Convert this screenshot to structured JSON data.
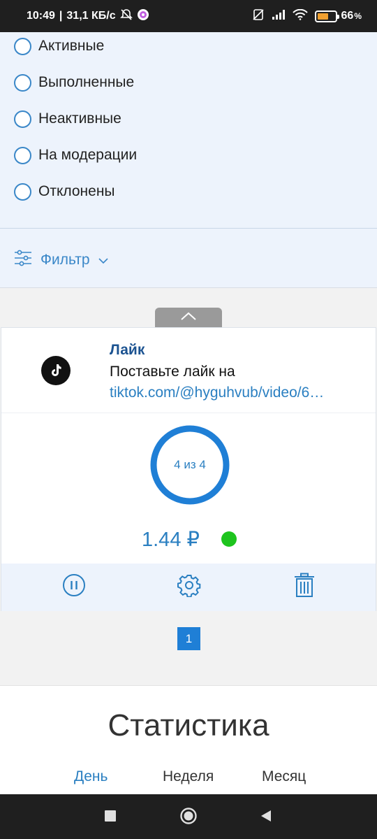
{
  "status_bar": {
    "time": "10:49",
    "network_speed": "31,1 КБ/с",
    "battery_percent": "66",
    "battery_level": 0.66,
    "battery_color": "#f0a030"
  },
  "filter": {
    "status_options": [
      {
        "label": "Активные",
        "checked": false
      },
      {
        "label": "Выполненные",
        "checked": false
      },
      {
        "label": "Неактивные",
        "checked": false
      },
      {
        "label": "На модерации",
        "checked": false
      },
      {
        "label": "Отклонены",
        "checked": false
      }
    ],
    "toggle_label": "Фильтр",
    "toggle_icon": "sliders-icon"
  },
  "task": {
    "platform_icon": "tiktok-icon",
    "title": "Лайк",
    "description": "Поставьте лайк на",
    "link": "tiktok.com/@hyguhvub/video/6…",
    "progress_text": "4 из 4",
    "progress_fraction": 1.0,
    "price": "1.44 ₽",
    "status_color": "#1ec41e",
    "actions": [
      "pause-icon",
      "settings-icon",
      "trash-icon"
    ]
  },
  "pagination": {
    "current_page": "1"
  },
  "statistics": {
    "title": "Статистика",
    "tabs": [
      {
        "label": "День",
        "active": true
      },
      {
        "label": "Неделя",
        "active": false
      },
      {
        "label": "Месяц",
        "active": false
      }
    ]
  },
  "colors": {
    "accent": "#2a7fc1",
    "title_blue": "#1c5391",
    "panel_bg": "#edf3fc",
    "page_button": "#1f7fd6"
  }
}
